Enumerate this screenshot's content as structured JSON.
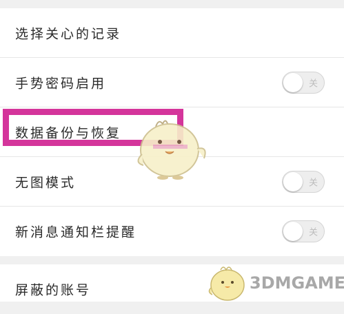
{
  "settings": {
    "group1": [
      {
        "label": "选择关心的记录"
      },
      {
        "label": "手势密码启用",
        "toggle": "关"
      },
      {
        "label": "数据备份与恢复"
      },
      {
        "label": "无图模式",
        "toggle": "关"
      },
      {
        "label": "新消息通知栏提醒",
        "toggle": "关"
      }
    ],
    "group2": [
      {
        "label": "屏蔽的账号"
      }
    ]
  },
  "watermark": {
    "text": "3DMGAME"
  },
  "colors": {
    "highlight": "#d4359b",
    "background": "#f0f0f0"
  }
}
